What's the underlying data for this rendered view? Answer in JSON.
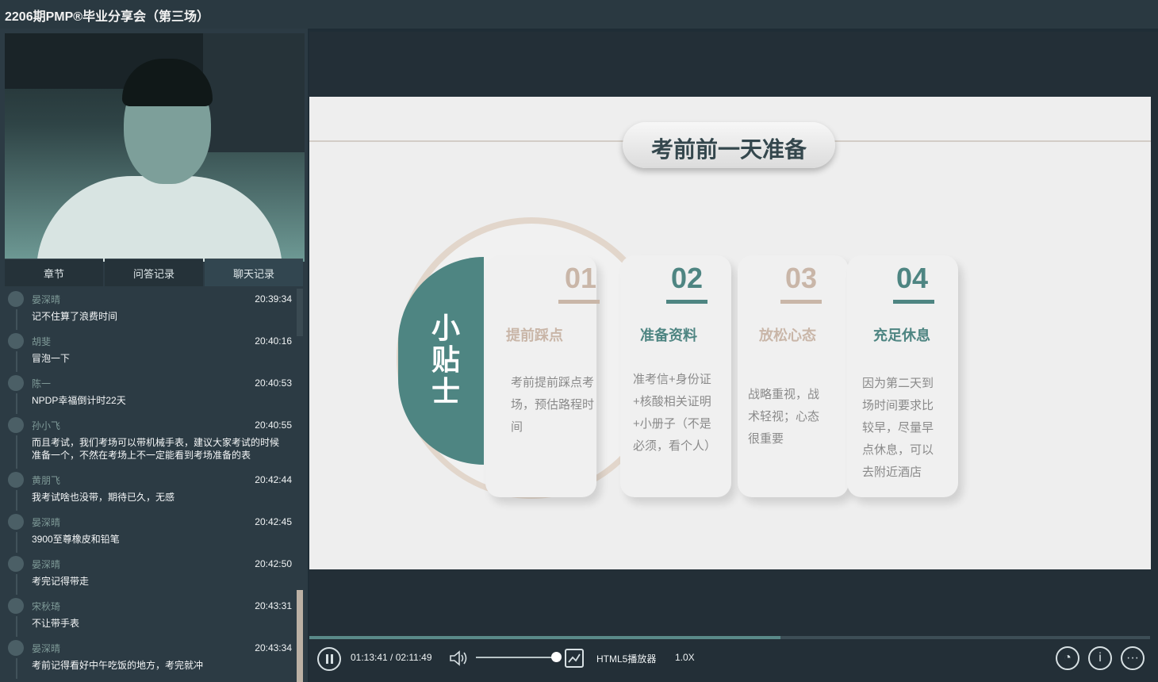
{
  "window": {
    "title": "2206期PMP®毕业分享会（第三场）"
  },
  "tabs": [
    {
      "label": "章节"
    },
    {
      "label": "问答记录"
    },
    {
      "label": "聊天记录"
    }
  ],
  "chat": [
    {
      "name": "晏深晴",
      "time": "20:39:34",
      "text": "记不住算了浪费时间"
    },
    {
      "name": "胡斐",
      "time": "20:40:16",
      "text": "冒泡一下"
    },
    {
      "name": "陈一",
      "time": "20:40:53",
      "text": "NPDP幸福倒计时22天"
    },
    {
      "name": "孙小飞",
      "time": "20:40:55",
      "text": "而且考试，我们考场可以带机械手表，建议大家考试的时候准备一个，不然在考场上不一定能看到考场准备的表"
    },
    {
      "name": "黄朋飞",
      "time": "20:42:44",
      "text": "我考试啥也没带，期待已久，无感"
    },
    {
      "name": "晏深晴",
      "time": "20:42:45",
      "text": "3900至尊橡皮和铅笔"
    },
    {
      "name": "晏深晴",
      "time": "20:42:50",
      "text": "考完记得带走"
    },
    {
      "name": "宋秋琦",
      "time": "20:43:31",
      "text": "不让带手表"
    },
    {
      "name": "晏深晴",
      "time": "20:43:34",
      "text": "考前记得看好中午吃饭的地方，考完就冲"
    }
  ],
  "slide": {
    "title": "考前前一天准备",
    "badge": "小贴士",
    "items": [
      {
        "num": "01",
        "head": "提前踩点",
        "desc": "考前提前踩点考场，预估路程时间",
        "color": "#c9b6a8"
      },
      {
        "num": "02",
        "head": "准备资料",
        "desc": "准考信+身份证+核酸相关证明+小册子（不是必须，看个人）",
        "color": "#4e8582"
      },
      {
        "num": "03",
        "head": "放松心态",
        "desc": "战略重视，战术轻视；心态很重要",
        "color": "#c9b6a8"
      },
      {
        "num": "04",
        "head": "充足休息",
        "desc": "因为第二天到场时间要求比较早，尽量早点休息，可以去附近酒店",
        "color": "#4e8582"
      }
    ]
  },
  "player": {
    "time": "01:13:41 / 02:11:49",
    "progress": 0.56,
    "volume": 0.95,
    "engine": "HTML5播放器",
    "speed": "1.0X"
  },
  "icons": {
    "play_pause": "pause-icon",
    "volume": "volume-icon",
    "mode": "trend-mode-icon",
    "people": "people-icon",
    "info": "info-icon",
    "more": "more-icon"
  }
}
